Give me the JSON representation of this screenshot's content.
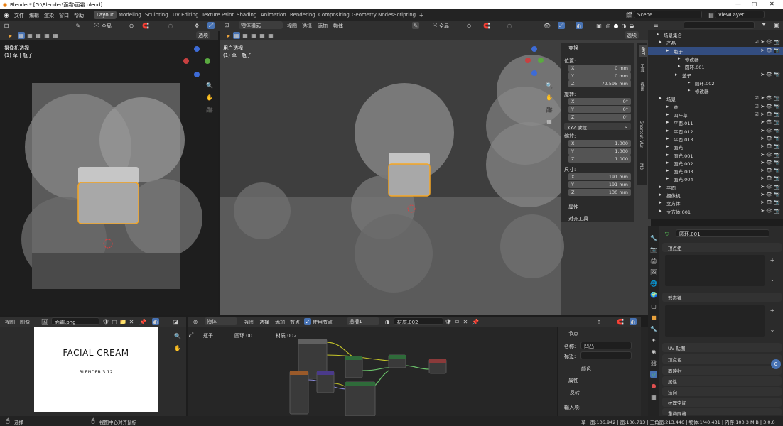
{
  "title": "Blender* [G:\\Blender\\面霜\\面霜.blend]",
  "menus": [
    "文件",
    "编辑",
    "渲染",
    "窗口",
    "帮助"
  ],
  "workspaces": [
    "Layout",
    "Modeling",
    "Sculpting",
    "UV Editing",
    "Texture Paint",
    "Shading",
    "Animation",
    "Rendering",
    "Compositing",
    "Geometry Nodes",
    "Scripting"
  ],
  "scene": "Scene",
  "view_layer": "ViewLayer",
  "left_viewport": {
    "global": "全局",
    "options": "选项",
    "view_name": "摄像机透视",
    "object_name": "(1) 草 | 瓶子"
  },
  "main_viewport": {
    "mode": "物体模式",
    "menu": [
      "视图",
      "选择",
      "添加",
      "物体"
    ],
    "global": "全局",
    "options": "选项",
    "view_name": "用户透视",
    "object_name": "(1) 草 | 瓶子"
  },
  "npanel": {
    "transform": "变换",
    "location": "位置:",
    "loc": [
      {
        "a": "X",
        "v": "0 mm"
      },
      {
        "a": "Y",
        "v": "0 mm"
      },
      {
        "a": "Z",
        "v": "79.595 mm"
      }
    ],
    "rotation": "旋转:",
    "rot": [
      {
        "a": "X",
        "v": "0°"
      },
      {
        "a": "Y",
        "v": "0°"
      },
      {
        "a": "Z",
        "v": "0°"
      }
    ],
    "rot_mode": "XYZ 欧拉",
    "scale": "缩放:",
    "scl": [
      {
        "a": "X",
        "v": "1.000"
      },
      {
        "a": "Y",
        "v": "1.000"
      },
      {
        "a": "Z",
        "v": "1.000"
      }
    ],
    "dimensions": "尺寸:",
    "dim": [
      {
        "a": "X",
        "v": "191 mm"
      },
      {
        "a": "Y",
        "v": "191 mm"
      },
      {
        "a": "Z",
        "v": "130 mm"
      }
    ],
    "properties": "属性",
    "align_tools": "对齐工具",
    "tabs": [
      "条目",
      "工具",
      "视图",
      "Shortcut VUr",
      "M3"
    ]
  },
  "outliner": {
    "rows": [
      {
        "name": "场景集合",
        "indent": 14,
        "sel": false,
        "right": ""
      },
      {
        "name": "产品",
        "indent": 18,
        "sel": false,
        "right": "☑ ➤ 👁 📷"
      },
      {
        "name": "瓶子",
        "indent": 28,
        "sel": true,
        "right": "➤ 👁 📷"
      },
      {
        "name": "修改器",
        "indent": 44,
        "sel": false,
        "right": ""
      },
      {
        "name": "圆环.001",
        "indent": 44,
        "sel": false,
        "right": ""
      },
      {
        "name": "盖子",
        "indent": 40,
        "sel": false,
        "right": "➤ 👁 📷"
      },
      {
        "name": "圆环.002",
        "indent": 58,
        "sel": false,
        "right": ""
      },
      {
        "name": "修改器",
        "indent": 58,
        "sel": false,
        "right": ""
      },
      {
        "name": "场景",
        "indent": 18,
        "sel": false,
        "right": "☑ ➤ 👁 📷"
      },
      {
        "name": "草",
        "indent": 28,
        "sel": false,
        "right": "☑ ➤ 👁 📷"
      },
      {
        "name": "四叶草",
        "indent": 28,
        "sel": false,
        "right": "☑ ➤ 👁 📷"
      },
      {
        "name": "平面.011",
        "indent": 28,
        "sel": false,
        "right": "➤ 👁 📷"
      },
      {
        "name": "平面.012",
        "indent": 28,
        "sel": false,
        "right": "➤ 👁 📷"
      },
      {
        "name": "平面.013",
        "indent": 28,
        "sel": false,
        "right": "➤ 👁 📷"
      },
      {
        "name": "面光",
        "indent": 28,
        "sel": false,
        "right": "➤ 👁 📷"
      },
      {
        "name": "面光.001",
        "indent": 28,
        "sel": false,
        "right": "➤ 👁 📷"
      },
      {
        "name": "面光.002",
        "indent": 28,
        "sel": false,
        "right": "➤ 👁 📷"
      },
      {
        "name": "面光.003",
        "indent": 28,
        "sel": false,
        "right": "➤ 👁 📷"
      },
      {
        "name": "面光.004",
        "indent": 28,
        "sel": false,
        "right": "➤ 👁 📷"
      },
      {
        "name": "平面",
        "indent": 18,
        "sel": false,
        "right": "➤ 👁 📷"
      },
      {
        "name": "摄像机",
        "indent": 18,
        "sel": false,
        "right": "➤ 👁 📷"
      },
      {
        "name": "立方体",
        "indent": 18,
        "sel": false,
        "right": "➤ 👁 📷"
      },
      {
        "name": "立方体.001",
        "indent": 18,
        "sel": false,
        "right": "➤ 👁 📷"
      }
    ]
  },
  "properties": {
    "mesh_name": "圆环.001",
    "sections": [
      "顶点组",
      "形态键",
      "UV 贴图",
      "顶点色",
      "面映射",
      "属性",
      "法向",
      "纹理空间",
      "重构网格"
    ],
    "badge": "0"
  },
  "image_editor": {
    "menu": [
      "视图",
      "图像"
    ],
    "image_name": "面霜.png",
    "label_title": "FACIAL CREAM",
    "label_sub": "BLENDER 3.12"
  },
  "node_editor": {
    "mode": "物体",
    "menu": [
      "视图",
      "选择",
      "添加",
      "节点"
    ],
    "use_nodes": "使用节点",
    "slot": "插槽1",
    "material": "材质.002",
    "breadcrumb": [
      "瓶子",
      "圆环.001",
      "材质.002"
    ],
    "panel": {
      "node": "节点",
      "name_label": "名称:",
      "name_value": "凹凸",
      "tag_label": "标签:",
      "color": "颜色",
      "props": "属性",
      "invert": "反转",
      "input": "输入项:"
    }
  },
  "status": {
    "left": "选择",
    "mid": "视图中心对齐鼠标",
    "right": "草 | 面:106.942 | 面:106.713 | 三角面:213.446 | 物体:1/40.431 | 内存:100.3 MiB | 3.0.0"
  },
  "colors": {
    "accent": "#4772b3",
    "selection": "#334d80",
    "orange": "#f5a623",
    "header": "#303030"
  }
}
